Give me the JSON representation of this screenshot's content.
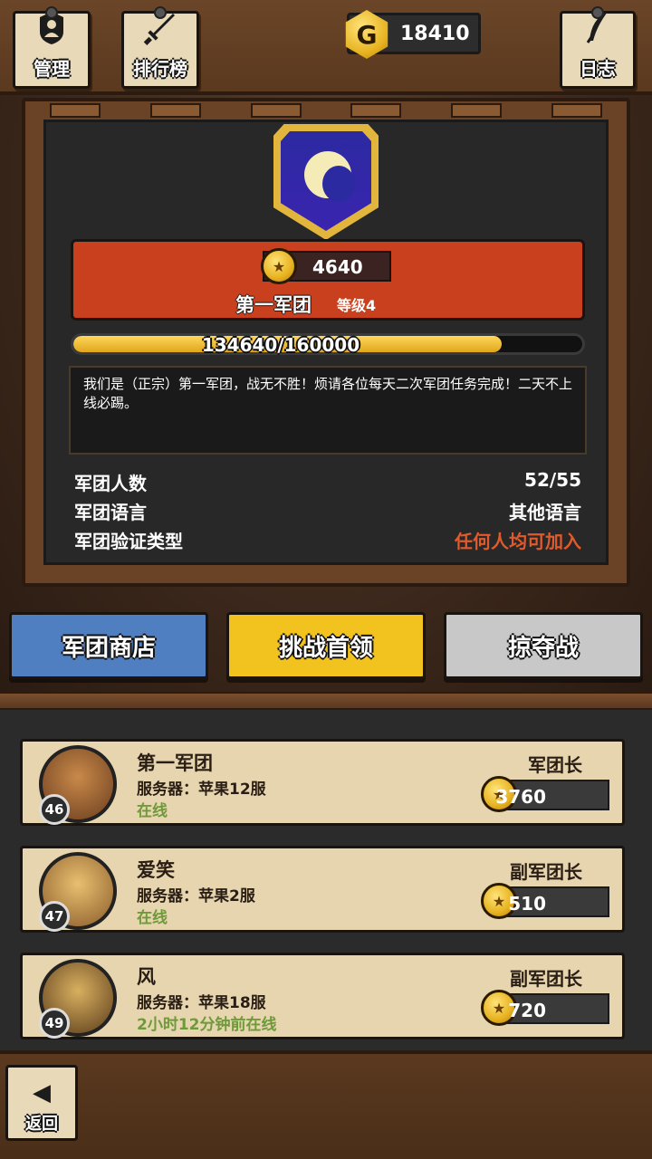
{
  "header": {
    "manage_label": "管理",
    "ranking_label": "排行榜",
    "log_label": "日志",
    "gold_icon": "G",
    "gold_value": "18410"
  },
  "guild": {
    "emblem_icon": "moon-emblem-icon",
    "score": "4640",
    "name": "第一军团",
    "level": "等级4",
    "xp_text": "134640/160000",
    "xp_fraction": 0.8415,
    "description": "我们是（正宗）第一军团，战无不胜！烦请各位每天二次军团任务完成！二天不上线必踢。",
    "info": [
      {
        "label": "军团人数",
        "value": "52/55"
      },
      {
        "label": "军团语言",
        "value": "其他语言"
      },
      {
        "label": "军团验证类型",
        "value": "任何人均可加入"
      }
    ]
  },
  "actions": {
    "shop": "军团商店",
    "challenge": "挑战首领",
    "raid": "掠夺战"
  },
  "members": [
    {
      "name": "第一军团",
      "server": "服务器：苹果12服",
      "status": "在线",
      "role": "军团长",
      "points": "3760",
      "level": "46"
    },
    {
      "name": "爱笑",
      "server": "服务器：苹果2服",
      "status": "在线",
      "role": "副军团长",
      "points": "510",
      "level": "47"
    },
    {
      "name": "风",
      "server": "服务器：苹果18服",
      "status": "2小时12分钟前在线",
      "role": "副军团长",
      "points": "720",
      "level": "49"
    }
  ],
  "footer": {
    "back_label": "返回",
    "back_icon": "◀"
  },
  "colors": {
    "banner_red": "#c8401e",
    "shop_blue": "#4f7fc0",
    "challenge_yellow": "#f2c21f",
    "raid_gray": "#c8c8c8",
    "verify_red": "#e05a2c",
    "online_green": "#6e9a3a"
  }
}
